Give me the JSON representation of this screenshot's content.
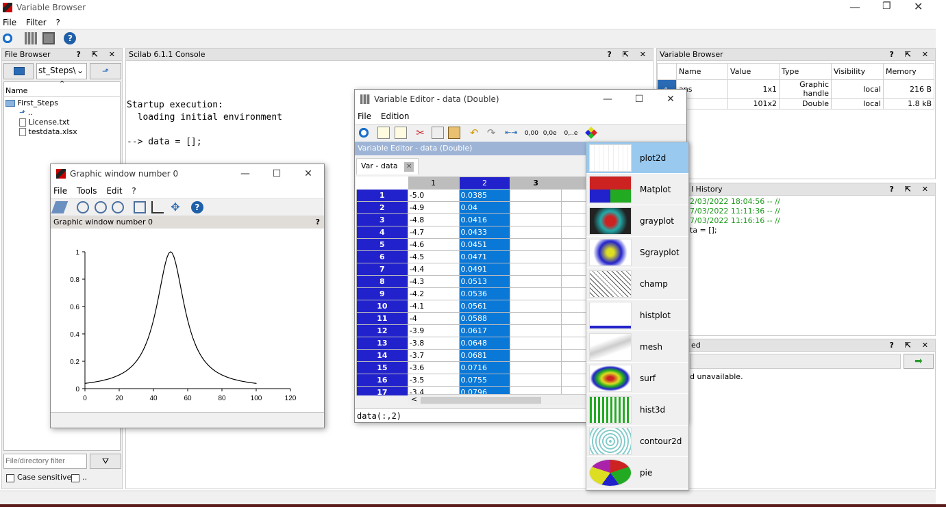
{
  "app": {
    "title": "Variable Browser",
    "menu": [
      "File",
      "Filter",
      "?"
    ]
  },
  "file_browser": {
    "title": "File Browser",
    "path": "st_Steps\\",
    "column": "Name",
    "items": [
      "First_Steps",
      "..",
      "License.txt",
      "testdata.xlsx"
    ],
    "filter_placeholder": "File/directory filter",
    "case_sensitive": "Case sensitive",
    "other_option": ".."
  },
  "console": {
    "title": "Scilab 6.1.1 Console",
    "lines": [
      "Startup execution:",
      "  loading initial environment",
      "",
      "--> data = [];",
      "",
      "-->"
    ]
  },
  "variable_browser": {
    "title": "Variable Browser",
    "columns": [
      "Name",
      "Value",
      "Type",
      "Visibility",
      "Memory"
    ],
    "rows": [
      {
        "name": "ans",
        "value": "1x1",
        "type": "Graphic handle",
        "visibility": "local",
        "memory": "216 B"
      },
      {
        "name": "ta",
        "value": "101x2",
        "type": "Double",
        "visibility": "local",
        "memory": "1.8 kB"
      }
    ]
  },
  "history": {
    "title": "l History",
    "lines": [
      "2/03/2022 18:04:56 -- //",
      "7/03/2022 11:11:36 -- //",
      "7/03/2022 11:16:16 -- //",
      "ta = [];"
    ]
  },
  "news": {
    "title": "ed",
    "text": "d unavailable."
  },
  "graphic_window": {
    "title": "Graphic window number 0",
    "menu": [
      "File",
      "Tools",
      "Edit",
      "?"
    ],
    "subtitle": "Graphic window number 0",
    "help": "?"
  },
  "chart_data": {
    "type": "line",
    "title": "",
    "xlabel": "",
    "ylabel": "",
    "xlim": [
      0,
      120
    ],
    "ylim": [
      0,
      1
    ],
    "xticks": [
      "0",
      "20",
      "40",
      "60",
      "80",
      "100",
      "120"
    ],
    "yticks": [
      "0",
      "0.2",
      "0.4",
      "0.6",
      "0.8",
      "1"
    ],
    "x": [
      0,
      10,
      20,
      30,
      35,
      40,
      45,
      48,
      50,
      52,
      55,
      60,
      65,
      70,
      80,
      90,
      100
    ],
    "y": [
      0.0385,
      0.0588,
      0.0999,
      0.2,
      0.2999,
      0.5,
      0.8,
      0.9615,
      1.0,
      0.9615,
      0.8,
      0.5,
      0.2999,
      0.2,
      0.0999,
      0.0588,
      0.0385
    ],
    "grid": false
  },
  "variable_editor": {
    "title": "Variable Editor - data  (Double)",
    "menu": [
      "File",
      "Edition"
    ],
    "dock_title": "Variable Editor - data  (Double)",
    "tab": "Var - data",
    "format_buttons": [
      "0,00",
      "0,0e",
      "0,..e"
    ],
    "col_headers": [
      "1",
      "2",
      "3"
    ],
    "rows": [
      [
        "1",
        "-5.0",
        "0.0385"
      ],
      [
        "2",
        "-4.9",
        "0.04"
      ],
      [
        "3",
        "-4.8",
        "0.0416"
      ],
      [
        "4",
        "-4.7",
        "0.0433"
      ],
      [
        "5",
        "-4.6",
        "0.0451"
      ],
      [
        "6",
        "-4.5",
        "0.0471"
      ],
      [
        "7",
        "-4.4",
        "0.0491"
      ],
      [
        "8",
        "-4.3",
        "0.0513"
      ],
      [
        "9",
        "-4.2",
        "0.0536"
      ],
      [
        "10",
        "-4.1",
        "0.0561"
      ],
      [
        "11",
        "-4",
        "0.0588"
      ],
      [
        "12",
        "-3.9",
        "0.0617"
      ],
      [
        "13",
        "-3.8",
        "0.0648"
      ],
      [
        "14",
        "-3.7",
        "0.0681"
      ],
      [
        "15",
        "-3.6",
        "0.0716"
      ],
      [
        "16",
        "-3.5",
        "0.0755"
      ],
      [
        "17",
        "-3.4",
        "0.0796"
      ]
    ],
    "status": "data(:,2)"
  },
  "plot_menu": [
    "plot2d",
    "Matplot",
    "grayplot",
    "Sgrayplot",
    "champ",
    "histplot",
    "mesh",
    "surf",
    "hist3d",
    "contour2d",
    "pie"
  ]
}
